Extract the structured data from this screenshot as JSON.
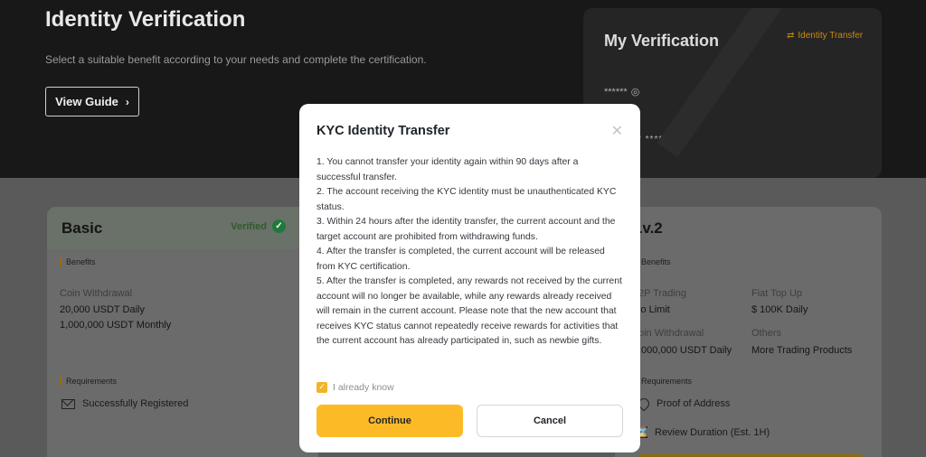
{
  "hero": {
    "title": "Identity Verification",
    "subtitle": "Select a suitable benefit according to your needs and complete the certification.",
    "guide_label": "View Guide",
    "guide_chevron": "›"
  },
  "my_card": {
    "title": "My Verification",
    "transfer_icon": "⇄",
    "transfer_label": "Identity Transfer",
    "masked_line1": "******",
    "eye_icon": "◎",
    "masked_line2": "* **** ****"
  },
  "basic": {
    "title": "Basic",
    "status": "Verified",
    "status_icon": "✓",
    "benefits_label": "Benefits",
    "coin_withdrawal_label": "Coin Withdrawal",
    "daily": "20,000 USDT Daily",
    "monthly": "1,000,000 USDT Monthly",
    "requirements_label": "Requirements",
    "requirement1": "Successfully Registered"
  },
  "lv2": {
    "title": "Lv.2",
    "benefits_label": "Benefits",
    "p2p_label": "2P Trading",
    "p2p_value": "lo Limit",
    "fiat_label": "Fiat Top Up",
    "fiat_value": "$ 100K Daily",
    "coin_label": "oin Withdrawal",
    "coin_value": ",000,000 USDT Daily",
    "others_label": "Others",
    "others_value": "More Trading Products",
    "requirements_label": "Requirements",
    "req1": "Proof of Address",
    "req2": "Review Duration (Est. 1H)"
  },
  "modal": {
    "title": "KYC Identity Transfer",
    "close_icon": "✕",
    "items": [
      "1. You cannot transfer your identity again within 90 days after a successful transfer.",
      "2. The account receiving the KYC identity must be unauthenticated KYC status.",
      "3. Within 24 hours after the identity transfer, the current account and the target account are prohibited from withdrawing funds.",
      "4. After the transfer is completed, the current account will be released from KYC certification.",
      "5. After the transfer is completed, any rewards not received by the current account will no longer be available, while any rewards already received will remain in the current account. Please note that the new account that receives KYC status cannot repeatedly receive rewards for activities that the current account has already participated in, such as newbie gifts."
    ],
    "checkbox_icon": "✓",
    "ack_label": "I already know",
    "continue_label": "Continue",
    "cancel_label": "Cancel"
  },
  "colors": {
    "accent": "#fcba27",
    "verified_green": "#1f7a3a",
    "overlay": "#4a4a4a"
  }
}
